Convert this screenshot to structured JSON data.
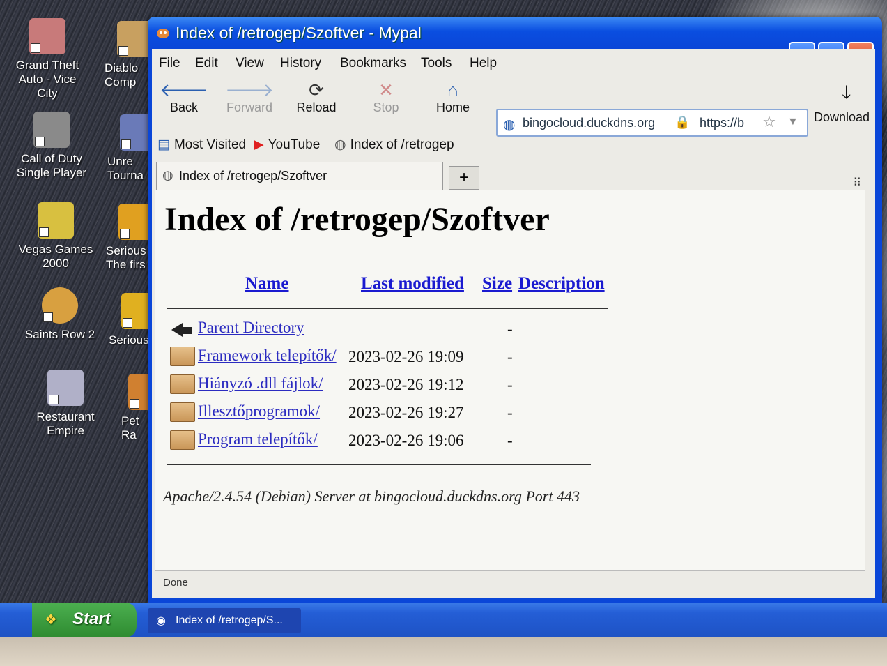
{
  "desktop": {
    "icons": [
      {
        "line1": "Grand Theft",
        "line2": "Auto - Vice City",
        "color": "#c87a7a"
      },
      {
        "line1": "Diablo",
        "line2": "Comp",
        "color": "#c8a060"
      },
      {
        "line1": "Call of Duty",
        "line2": "Single Player",
        "color": "#8a8a8a"
      },
      {
        "line1": "Unre",
        "line2": "Tourna",
        "color": "#6a7ab8"
      },
      {
        "line1": "Vegas Games",
        "line2": "2000",
        "color": "#d8c040"
      },
      {
        "line1": "Serious",
        "line2": "The firs",
        "color": "#e0a020"
      },
      {
        "line1": "Saints Row 2",
        "line2": "",
        "color": "#d8a040"
      },
      {
        "line1": "Serious",
        "line2": "",
        "color": "#e0b020"
      },
      {
        "line1": "Restaurant",
        "line2": "Empire",
        "color": "#b0b0c8"
      },
      {
        "line1": "Pet Ra",
        "line2": "",
        "color": "#d08030"
      }
    ]
  },
  "window": {
    "title": "Index of /retrogep/Szoftver - Mypal",
    "controls": {
      "minimize": "_",
      "maximize": "□",
      "close": "✕"
    }
  },
  "menu": {
    "file": "File",
    "edit": "Edit",
    "view": "View",
    "history": "History",
    "bookmarks": "Bookmarks",
    "tools": "Tools",
    "help": "Help"
  },
  "nav": {
    "back": "Back",
    "forward": "Forward",
    "reload": "Reload",
    "stop": "Stop",
    "home": "Home",
    "download": "Download"
  },
  "urlbar": {
    "domain": "bingocloud.duckdns.org",
    "text": "https://b"
  },
  "bookmarks_bar": {
    "most_visited": "Most Visited",
    "youtube": "YouTube",
    "index": "Index of /retrogep"
  },
  "tab": {
    "label": "Index of /retrogep/Szoftver",
    "new_tab": "+"
  },
  "page": {
    "heading": "Index of /retrogep/Szoftver",
    "columns": {
      "name": "Name",
      "last_modified": "Last modified",
      "size": "Size",
      "description": "Description"
    },
    "parent": {
      "name": "Parent Directory",
      "size": "-"
    },
    "entries": [
      {
        "name": "Framework telepítők/",
        "date": "2023-02-26 19:09",
        "size": "-"
      },
      {
        "name": "Hiányzó .dll fájlok/",
        "date": "2023-02-26 19:12",
        "size": "-"
      },
      {
        "name": "Illesztőprogramok/",
        "date": "2023-02-26 19:27",
        "size": "-"
      },
      {
        "name": "Program telepítők/",
        "date": "2023-02-26 19:06",
        "size": "-"
      }
    ],
    "server_signature": "Apache/2.4.54 (Debian) Server at bingocloud.duckdns.org Port 443"
  },
  "status": {
    "text": "Done"
  },
  "taskbar": {
    "start": "Start",
    "task_item": "Index of /retrogep/S..."
  }
}
